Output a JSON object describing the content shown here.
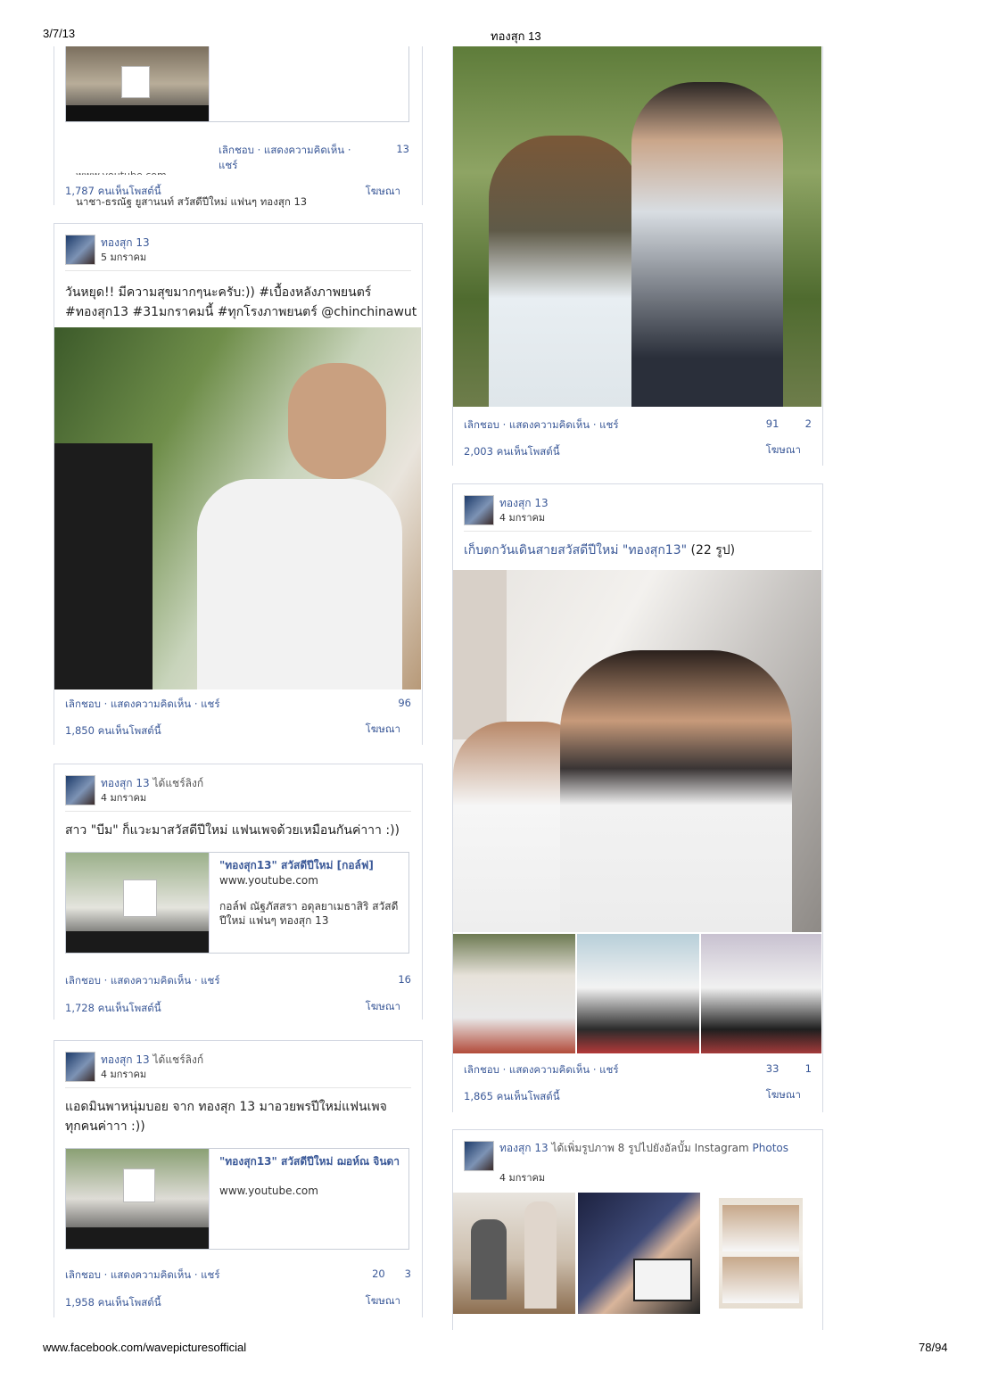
{
  "print_header": {
    "date": "3/7/13",
    "title": "ทองสุก 13"
  },
  "print_footer": {
    "url": "www.facebook.com/wavepicturesofficial",
    "page": "78/94"
  },
  "common": {
    "like": "เลิกชอบ",
    "comment": "แสดงความคิดเห็น",
    "share": "แชร์",
    "dot": "·",
    "sponsor": "โฆษณา"
  },
  "left": {
    "post0": {
      "counts": "13",
      "share_wrap": "แชร์",
      "overlap_text": "www.youtube.com",
      "seen": "1,787 คนเห็นโพสต์นี้",
      "desc": "นาชา-ธรณัฐ ยูสานนท์ สวัสดีปีใหม่ แฟนๆ ทองสุก 13"
    },
    "post1": {
      "author": "ทองสุก 13",
      "date": "5 มกราคม",
      "msg_line1": "วันหยุด!! มีความสุขมากๆนะครับ:)) #เบื้องหลังภาพยนตร์",
      "msg_line2": "#ทองสุก13 #31มกราคมนี้ #ทุกโรงภาพยนตร์ @chinchinawut",
      "counts": "96",
      "seen": "1,850 คนเห็นโพสต์นี้"
    },
    "post2": {
      "author": "ทองสุก 13",
      "author_rest": "ได้แชร์ลิงก์",
      "date": "4 มกราคม",
      "msg": "สาว \"บีม\" ก็แวะมาสวัสดีปีใหม่ แฟนเพจด้วยเหมือนกันค่าาา :))",
      "link_title": "\"ทองสุก13\" สวัสดีปีใหม่ [กอล์ฟ]",
      "link_url": "www.youtube.com",
      "link_desc": "กอล์ฟ ณัฐภัสสรา อดุลยาเมธาสิริ สวัสดีปีใหม่ แฟนๆ ทองสุก 13",
      "counts": "16",
      "seen": "1,728 คนเห็นโพสต์นี้"
    },
    "post3": {
      "author": "ทองสุก 13",
      "author_rest": "ได้แชร์ลิงก์",
      "date": "4 มกราคม",
      "msg_line1": "แอดมินพาหนุ่มบอย จาก ทองสุก 13 มาอวยพรปีใหม่แฟนเพจ",
      "msg_line2": "ทุกคนค่าาา :))",
      "link_title": "\"ทองสุก13\" สวัสดีปีใหม่ ฌอห์ณ จินดา",
      "link_url": "www.youtube.com",
      "counts_a": "20",
      "counts_b": "3",
      "seen": "1,958 คนเห็นโพสต์นี้"
    }
  },
  "right": {
    "post0": {
      "counts_a": "91",
      "counts_b": "2",
      "seen": "2,003 คนเห็นโพสต์นี้"
    },
    "post1": {
      "author": "ทองสุก 13",
      "date": "4 มกราคม",
      "album_link": "เก็บตกวันเดินสายสวัสดีปีใหม่ \"ทองสุก13\"",
      "album_count": "(22 รูป)",
      "counts_a": "33",
      "counts_b": "1",
      "seen": "1,865 คนเห็นโพสต์นี้"
    },
    "post2": {
      "author": "ทองสุก 13",
      "author_rest": "ได้เพิ่มรูปภาพ 8 รูปไปยังอัลบั้ม Instagram",
      "author_line2": "Photos",
      "date": "4 มกราคม"
    }
  }
}
